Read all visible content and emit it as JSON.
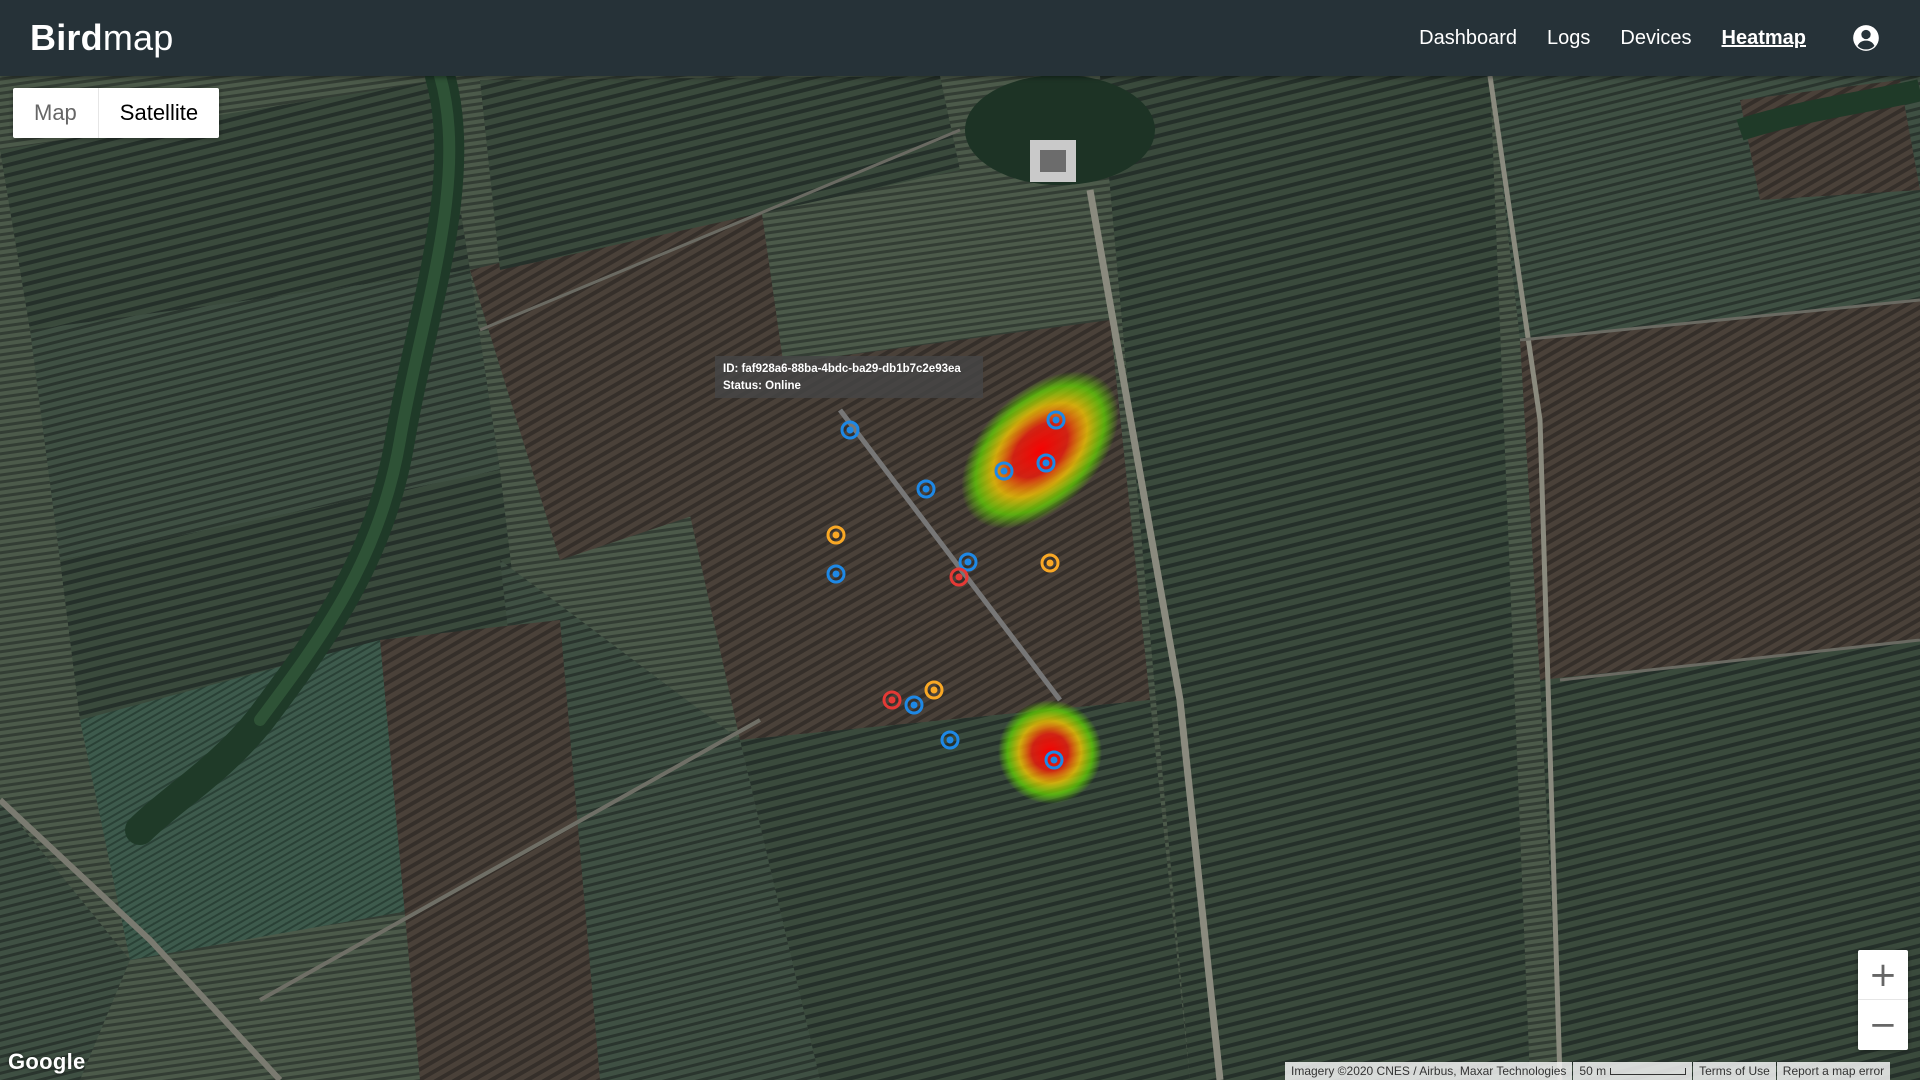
{
  "app": {
    "brand_bold": "Bird",
    "brand_light": "map",
    "nav": [
      "Dashboard",
      "Logs",
      "Devices",
      "Heatmap"
    ],
    "active_nav": "Heatmap"
  },
  "map": {
    "type_map": "Map",
    "type_satellite": "Satellite",
    "selected_type": "Satellite",
    "tooltip": {
      "id_line": "ID: faf928a6-88ba-4bdc-ba29-db1b7c2e93ea",
      "status_line": "Status: Online"
    },
    "zoom_in": "+",
    "zoom_out": "−",
    "google": "Google",
    "attribution": "Imagery ©2020 CNES / Airbus, Maxar Technologies",
    "scale_label": "50 m",
    "terms": "Terms of Use",
    "report": "Report a map error"
  },
  "colors": {
    "appbar": "#263238",
    "marker_online": "#1e88e5",
    "marker_warning": "#f9a825",
    "marker_error": "#e53935"
  },
  "markers": [
    {
      "status": "online"
    },
    {
      "status": "online"
    },
    {
      "status": "online"
    },
    {
      "status": "online"
    },
    {
      "status": "online"
    },
    {
      "status": "online"
    },
    {
      "status": "online"
    },
    {
      "status": "online"
    },
    {
      "status": "online"
    },
    {
      "status": "online"
    },
    {
      "status": "warning"
    },
    {
      "status": "warning"
    },
    {
      "status": "warning"
    },
    {
      "status": "error"
    },
    {
      "status": "error"
    }
  ]
}
